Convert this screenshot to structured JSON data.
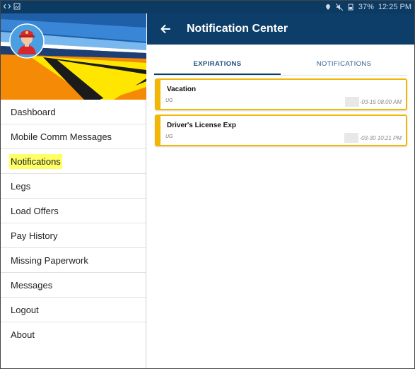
{
  "statusbar": {
    "time": "12:25 PM",
    "battery": "37%"
  },
  "drawer": {
    "items": [
      {
        "label": "Dashboard",
        "active": false
      },
      {
        "label": "Mobile Comm Messages",
        "active": false
      },
      {
        "label": "Notifications",
        "active": true
      },
      {
        "label": "Legs",
        "active": false
      },
      {
        "label": "Load Offers",
        "active": false
      },
      {
        "label": "Pay History",
        "active": false
      },
      {
        "label": "Missing Paperwork",
        "active": false
      },
      {
        "label": "Messages",
        "active": false
      },
      {
        "label": "Logout",
        "active": false
      },
      {
        "label": "About",
        "active": false
      }
    ]
  },
  "main": {
    "title": "Notification Center",
    "tabs": [
      {
        "label": "EXPIRATIONS",
        "active": true
      },
      {
        "label": "NOTIFICATIONS",
        "active": false
      }
    ],
    "cards": [
      {
        "title": "Vacation",
        "sub": "UG",
        "date": "-03-15 08:00 AM"
      },
      {
        "title": "Driver's License Exp",
        "sub": "UG",
        "date": "-03-30 10:21 PM"
      }
    ]
  },
  "colors": {
    "appbar": "#0d3d69",
    "accent_border": "#f2b705",
    "highlight": "#ffff66"
  },
  "icons": {
    "back": "arrow-left-icon",
    "avatar": "driver-avatar-icon"
  }
}
